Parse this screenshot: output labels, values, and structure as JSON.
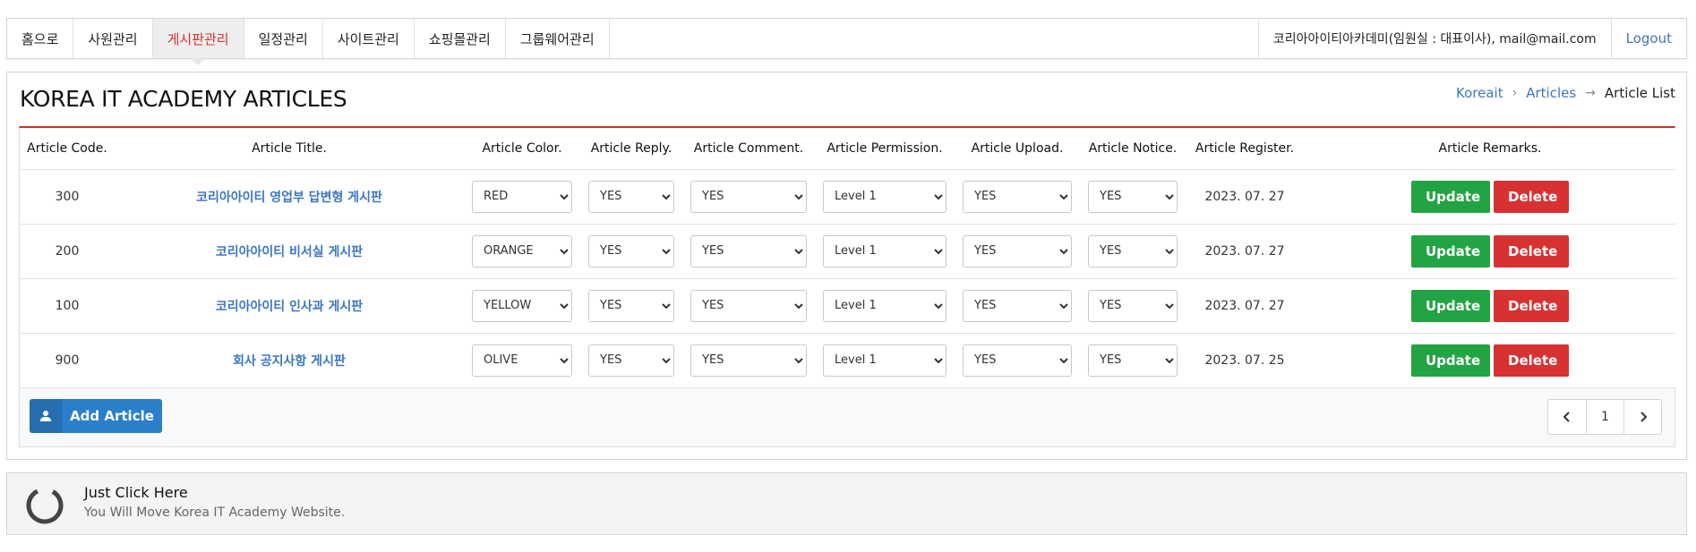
{
  "nav": {
    "items": [
      {
        "label": "홈으로",
        "active": false
      },
      {
        "label": "사원관리",
        "active": false
      },
      {
        "label": "게시판관리",
        "active": true
      },
      {
        "label": "일정관리",
        "active": false
      },
      {
        "label": "사이트관리",
        "active": false
      },
      {
        "label": "쇼핑몰관리",
        "active": false
      },
      {
        "label": "그룹웨어관리",
        "active": false
      }
    ],
    "user": "코리아아이티아카데미(임원실 : 대표이사), mail@mail.com",
    "logout": "Logout"
  },
  "page": {
    "title": "KOREA IT ACADEMY ARTICLES",
    "breadcrumb": [
      "Koreait",
      "Articles",
      "Article List"
    ]
  },
  "table": {
    "headers": [
      "Article Code.",
      "Article Title.",
      "Article Color.",
      "Article Reply.",
      "Article Comment.",
      "Article Permission.",
      "Article Upload.",
      "Article Notice.",
      "Article Register.",
      "Article Remarks."
    ],
    "rows": [
      {
        "code": "300",
        "title": "코리아아이티 영업부 답변형 게시판",
        "color": "RED",
        "reply": "YES",
        "comment": "YES",
        "permission": "Level 1",
        "upload": "YES",
        "notice": "YES",
        "register": "2023. 07. 27"
      },
      {
        "code": "200",
        "title": "코리아아이티 비서실 게시판",
        "color": "ORANGE",
        "reply": "YES",
        "comment": "YES",
        "permission": "Level 1",
        "upload": "YES",
        "notice": "YES",
        "register": "2023. 07. 27"
      },
      {
        "code": "100",
        "title": "코리아아이티 인사과 게시판",
        "color": "YELLOW",
        "reply": "YES",
        "comment": "YES",
        "permission": "Level 1",
        "upload": "YES",
        "notice": "YES",
        "register": "2023. 07. 27"
      },
      {
        "code": "900",
        "title": "회사 공지사항 게시판",
        "color": "OLIVE",
        "reply": "YES",
        "comment": "YES",
        "permission": "Level 1",
        "upload": "YES",
        "notice": "YES",
        "register": "2023. 07. 25"
      }
    ],
    "update_label": "Update",
    "delete_label": "Delete"
  },
  "footer": {
    "add_label": "Add Article",
    "page": "1"
  },
  "banner": {
    "title": "Just Click Here",
    "subtitle": "You Will Move Korea IT Academy Website."
  },
  "colors": {
    "accent_red": "#d8322f",
    "link_blue": "#3d76c0",
    "update_green": "#23a444",
    "delete_red": "#d83131",
    "add_blue": "#2b7ec9"
  },
  "icons": {
    "add": "user-icon",
    "prev": "chevron-left-icon",
    "next": "chevron-right-icon",
    "banner": "spinner-icon",
    "select": "chevron-down-icon"
  }
}
